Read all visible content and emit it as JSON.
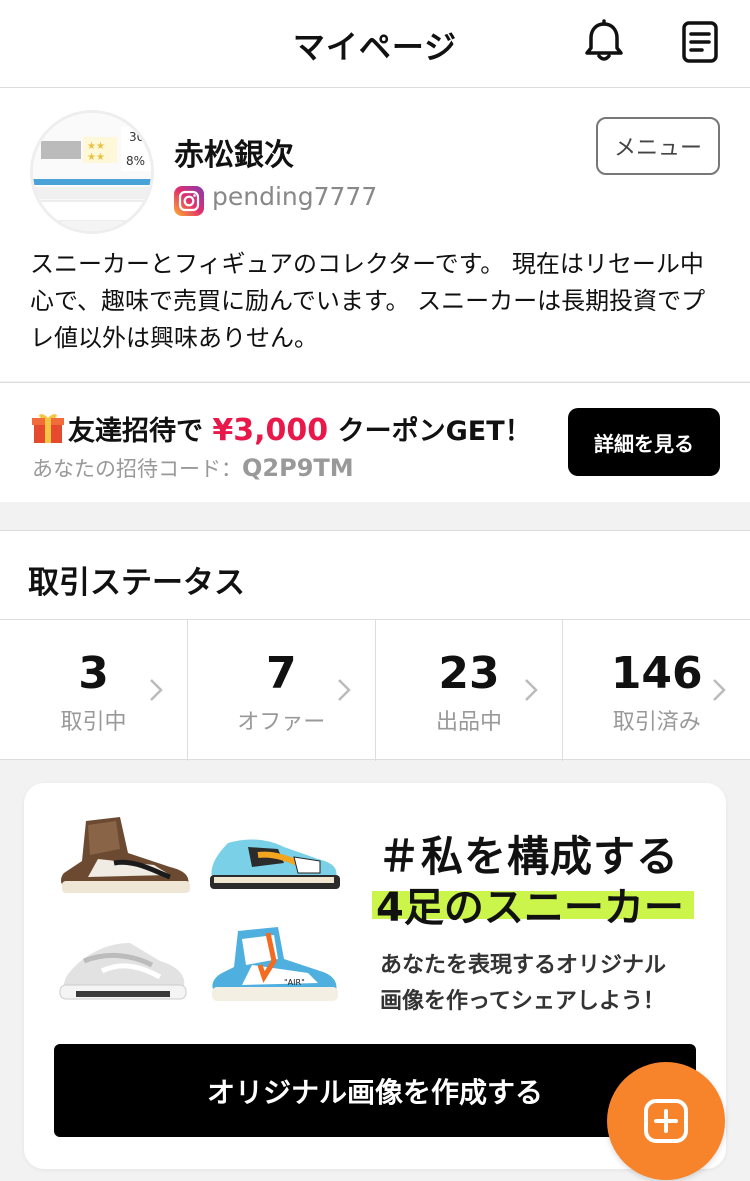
{
  "header": {
    "title": "マイページ"
  },
  "profile": {
    "name": "赤松銀次",
    "instagram_handle": "pending7777",
    "menu_label": "メニュー",
    "bio": "スニーカーとフィギュアのコレクターです。 現在はリセール中心で、趣味で売買に励んでいます。 スニーカーは長期投資でプレ値以外は興味ありせん。"
  },
  "invite": {
    "text_before": "友達招待で",
    "amount": "¥3,000",
    "text_after": "クーポンGET！",
    "code_label": "あなたの招待コード：",
    "code": "Q2P9TM",
    "detail_button": "詳細を見る"
  },
  "status": {
    "title": "取引ステータス",
    "items": [
      {
        "count": "3",
        "label": "取引中"
      },
      {
        "count": "7",
        "label": "オファー"
      },
      {
        "count": "23",
        "label": "出品中"
      },
      {
        "count": "146",
        "label": "取引済み"
      }
    ]
  },
  "promo": {
    "headline1": "＃私を構成する",
    "headline2": "4足のスニーカー",
    "sub1": "あなたを表現するオリジナル",
    "sub2": "画像を作ってシェアしよう！",
    "button": "オリジナル画像を作成する"
  },
  "colors": {
    "accent": "#e8194a",
    "highlight": "#cbf54a",
    "fab": "#f7832a"
  }
}
